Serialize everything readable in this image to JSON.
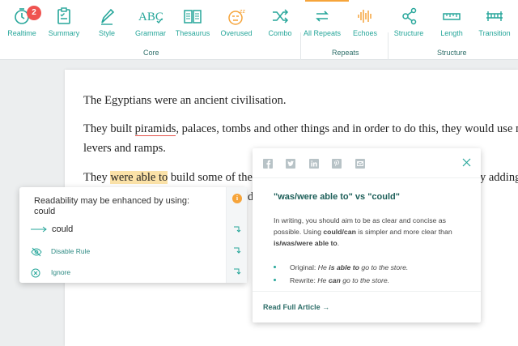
{
  "toolbar": {
    "tools": [
      {
        "label": "Realtime",
        "icon": "clock-icon"
      },
      {
        "label": "Summary",
        "icon": "clipboard-icon"
      },
      {
        "label": "Style",
        "icon": "pen-icon"
      },
      {
        "label": "Grammar",
        "icon": "abc-check-icon"
      },
      {
        "label": "Thesaurus",
        "icon": "book-icon"
      },
      {
        "label": "Overused",
        "icon": "sleepy-face-icon"
      },
      {
        "label": "Combo",
        "icon": "shuffle-icon"
      },
      {
        "label": "All Repeats",
        "icon": "repeat-icon"
      },
      {
        "label": "Echoes",
        "icon": "soundwave-icon"
      },
      {
        "label": "Structure",
        "icon": "network-icon"
      },
      {
        "label": "Length",
        "icon": "ruler-icon"
      },
      {
        "label": "Transition",
        "icon": "bridge-icon"
      }
    ],
    "badge_count": "2",
    "groups": {
      "core": "Core",
      "repeats": "Repeats",
      "structure": "Structure"
    },
    "accent_color": "#26a69a",
    "badge_color": "#ef5350"
  },
  "document": {
    "line1": "The Egyptians were an ancient civilisation.",
    "line2_pre": "They built ",
    "line2_misspelled": "piramids",
    "line2_post": ", palaces, tombs and other things and in order to do this, they would use mach",
    "line3": "levers and ramps.",
    "line4_pre": "They ",
    "line4_highlight": "were able to",
    "line4_post": " build some of the fa",
    "line4_right": "y adding",
    "line5_frag": "d"
  },
  "suggestion_card": {
    "message": "Readability may be enhanced by using:",
    "message_value": "could",
    "suggestion": "could",
    "disable_label": "Disable Rule",
    "ignore_label": "Ignore"
  },
  "info_card": {
    "title": "\"was/were able to\" vs \"could\"",
    "body_1": "In writing, you should aim to be as clear and concise as possible. Using ",
    "body_bold_1": "could/can",
    "body_2": " is simpler and more clear than ",
    "body_bold_2": "is/was/were able to",
    "body_3": ".",
    "original_label": "Original: ",
    "original_pre": "He ",
    "original_bold": "is able to",
    "original_post": " go to the store.",
    "rewrite_label": "Rewrite: ",
    "rewrite_pre": "He ",
    "rewrite_bold": "can",
    "rewrite_post": " go to the store.",
    "read_more": "Read Full Article →"
  }
}
